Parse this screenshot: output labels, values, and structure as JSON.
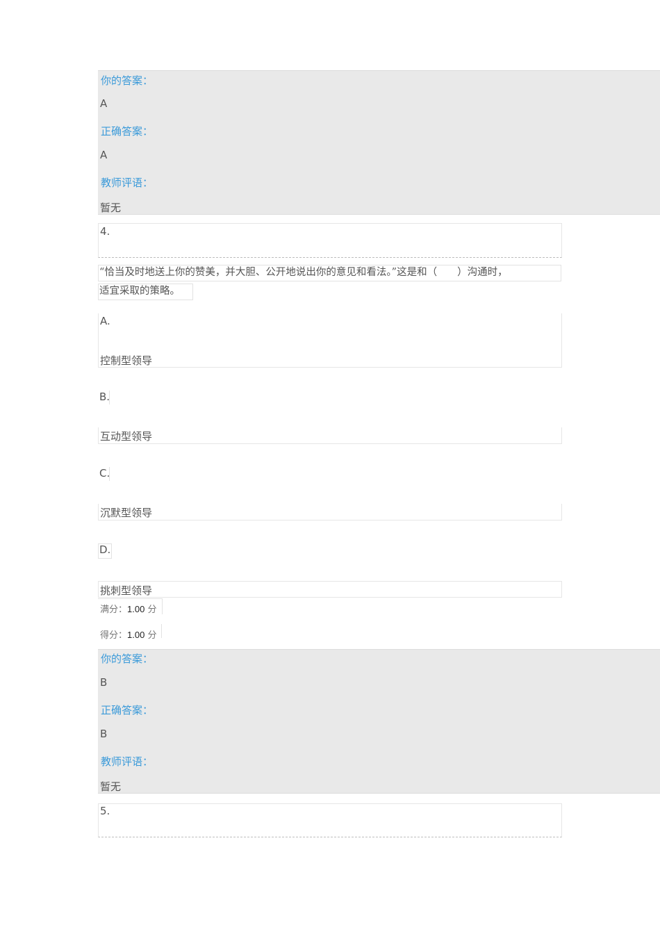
{
  "review_3": {
    "your_answer_label": "你的答案：",
    "your_answer": "A",
    "correct_answer_label": "正确答案：",
    "correct_answer": "A",
    "teacher_comment_label": "教师评语：",
    "teacher_comment": "暂无"
  },
  "question_4": {
    "number": "4.",
    "stem_line1": "“恰当及时地送上你的赞美，并大胆、公开地说出你的意见和看法。”这是和（　　）沟通时，",
    "stem_line2": "适宜采取的策略。",
    "options": [
      {
        "letter": "A.",
        "text": "控制型领导"
      },
      {
        "letter": "B.",
        "text": "互动型领导"
      },
      {
        "letter": "C.",
        "text": "沉默型领导"
      },
      {
        "letter": "D.",
        "text": "挑刺型领导"
      }
    ],
    "full_score_label": "满分：",
    "full_score_value": "1.00",
    "full_score_unit": "分",
    "score_label": "得分：",
    "score_value": "1.00",
    "score_unit": "分"
  },
  "review_4": {
    "your_answer_label": "你的答案：",
    "your_answer": "B",
    "correct_answer_label": "正确答案：",
    "correct_answer": "B",
    "teacher_comment_label": "教师评语：",
    "teacher_comment": "暂无"
  },
  "question_5": {
    "number": "5."
  }
}
